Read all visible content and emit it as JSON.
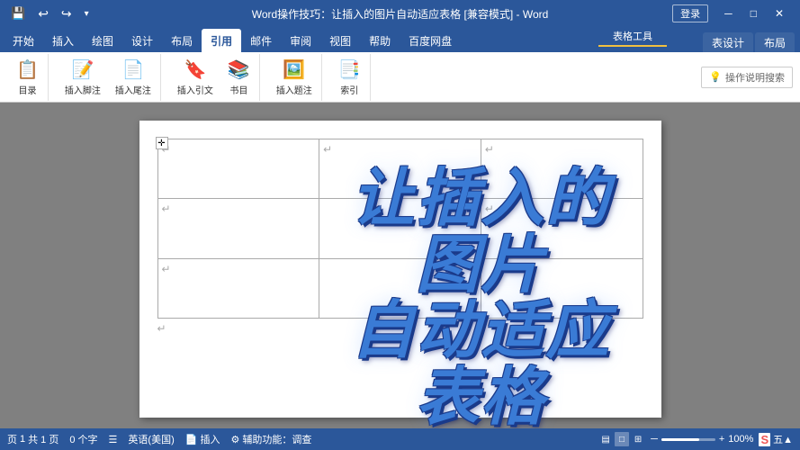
{
  "titleBar": {
    "title": "Word操作技巧：让插入的图片自动适应表格 [兼容模式] - Word",
    "appName": "Word",
    "loginBtn": "登录",
    "winMinimize": "─",
    "winRestore": "□",
    "winClose": "✕",
    "quickSave": "💾",
    "undoBtn": "↩",
    "redoBtn": "↪"
  },
  "ribbonTabs": {
    "contextLabel": "表格工具",
    "tabs": [
      {
        "label": "开始",
        "active": false
      },
      {
        "label": "插入",
        "active": false
      },
      {
        "label": "绘图",
        "active": false
      },
      {
        "label": "设计",
        "active": false
      },
      {
        "label": "布局",
        "active": false
      },
      {
        "label": "引用",
        "active": true
      },
      {
        "label": "邮件",
        "active": false
      },
      {
        "label": "审阅",
        "active": false
      },
      {
        "label": "视图",
        "active": false
      },
      {
        "label": "帮助",
        "active": false
      },
      {
        "label": "百度网盘",
        "active": false
      }
    ],
    "extraTabs": [
      {
        "label": "表设计"
      },
      {
        "label": "布局"
      }
    ],
    "helpSearch": "操作说明搜索",
    "helpIcon": "💡"
  },
  "statusBar": {
    "pageInfo": "共 1 页",
    "pageNum": "1",
    "wordCount": "0 个字",
    "macroIcon": "☰",
    "language": "英语(美国)",
    "insertMode": "插入",
    "pageIcon": "📄",
    "accessibilityLabel": "辅助功能：调查",
    "accessibilityIcon": "⚙",
    "zoomLevel": "100%",
    "sohuLabel": "S",
    "numbers": "五▲",
    "viewIcons": [
      "□",
      "□",
      "□"
    ]
  },
  "document": {
    "tableCells": [
      [
        {
          "marker": "↵"
        },
        {
          "marker": "↵"
        },
        {
          "marker": "↵"
        }
      ],
      [
        {
          "marker": "↵"
        },
        {
          "marker": ""
        },
        {
          "marker": "↵"
        }
      ],
      [
        {
          "marker": "↵"
        },
        {
          "marker": ""
        },
        {
          "marker": ""
        }
      ]
    ],
    "bigTitle": "让插入的\n图片\n自动适应\n表格"
  }
}
